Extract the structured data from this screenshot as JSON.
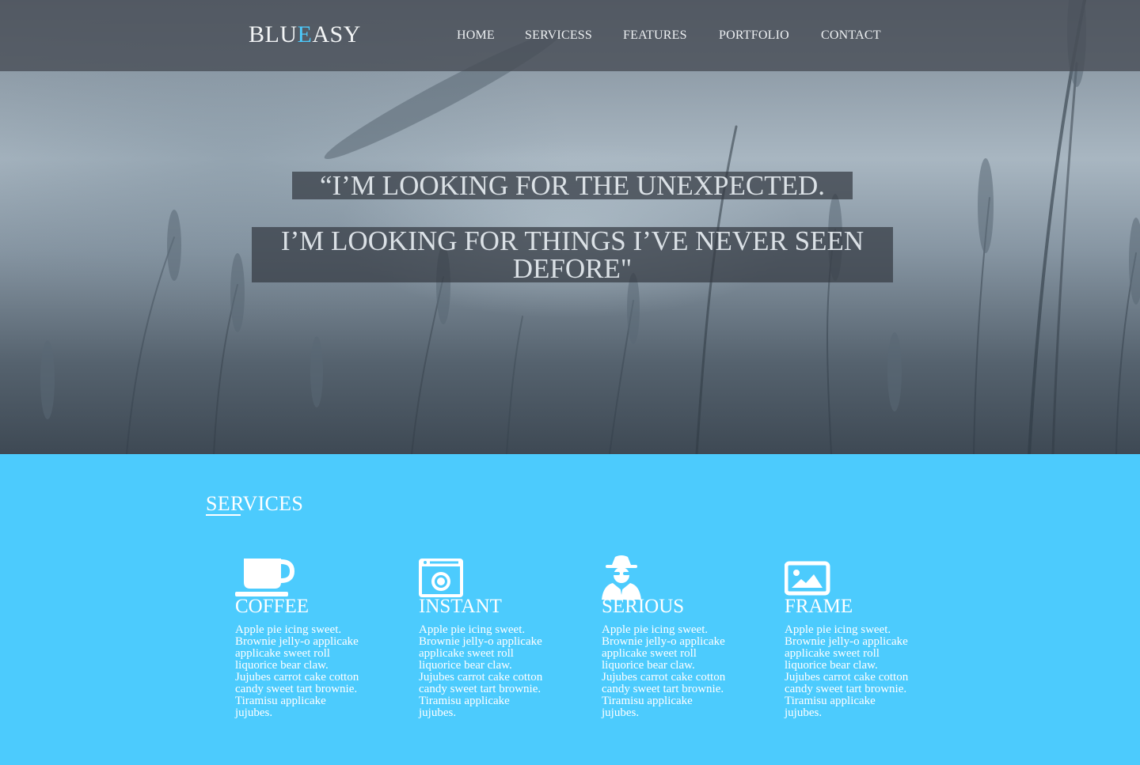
{
  "header": {
    "logo_part1": "BLU",
    "logo_accent": "E",
    "logo_part2": "ASY",
    "nav": [
      "HOME",
      "SERVICESS",
      "FEATURES",
      "PORTFOLIO",
      "CONTACT"
    ]
  },
  "hero": {
    "quote_line1": "“I’M LOOKING FOR THE UNEXPECTED.",
    "quote_line2": "I’M LOOKING FOR THINGS I’VE NEVER SEEN DEFORE\""
  },
  "services": {
    "title": "SERVICES",
    "items": [
      {
        "title": "COFFEE",
        "icon": "coffee-cup-icon",
        "text": "Apple pie icing sweet. Brownie jelly-o applicake applicake sweet roll liquorice bear claw. Jujubes carrot cake cotton candy sweet tart brownie. Tiramisu applicake jujubes."
      },
      {
        "title": "INSTANT",
        "icon": "camera-window-icon",
        "text": "Apple pie icing sweet. Brownie jelly-o applicake applicake sweet roll liquorice bear claw. Jujubes carrot cake cotton candy sweet tart brownie. Tiramisu applicake jujubes."
      },
      {
        "title": "SERIOUS",
        "icon": "spy-icon",
        "text": "Apple pie icing sweet. Brownie jelly-o applicake applicake sweet roll liquorice bear claw. Jujubes carrot cake cotton candy sweet tart brownie. Tiramisu applicake jujubes."
      },
      {
        "title": "FRAME",
        "icon": "picture-frame-icon",
        "text": "Apple pie icing sweet. Brownie jelly-o applicake applicake sweet roll liquorice bear claw. Jujubes carrot cake cotton candy sweet tart brownie. Tiramisu applicake jujubes."
      }
    ]
  },
  "colors": {
    "accent": "#4ccbfd",
    "navbar": "#464c54",
    "text_light": "#ffffff"
  }
}
